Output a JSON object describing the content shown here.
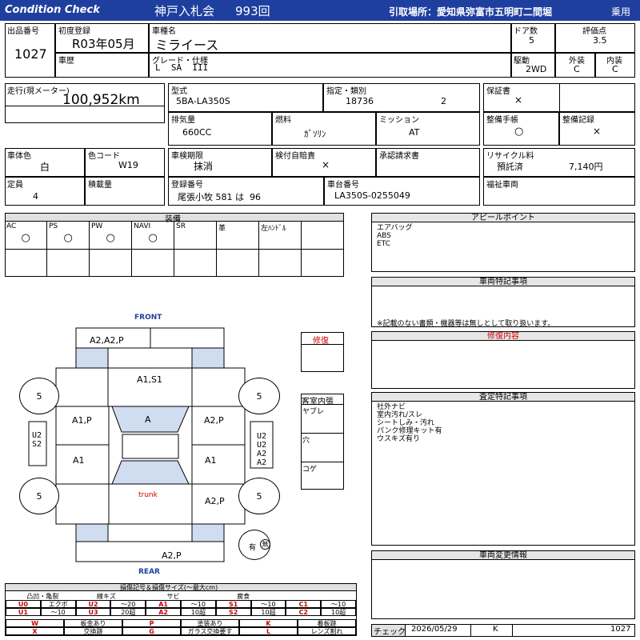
{
  "header": {
    "brand": "Condition Check",
    "auction": "神戸入札会",
    "lot_no": "993回",
    "pickup": "引取場所：愛知県弥富市五明町二間堀",
    "category": "乗用"
  },
  "row1": {
    "lot_label": "出品番号",
    "lot_value": "1027",
    "reg_label": "初度登録",
    "reg_value": "R03年05月",
    "history_label": "車歴",
    "name_label": "車種名",
    "name_value": "ミライース",
    "grade_label": "グレード・仕様",
    "grade_value": "L  SA  III",
    "doors_label": "ドア数",
    "doors_value": "5",
    "score_label": "評価点",
    "score_value": "3.5",
    "drive_label": "駆動",
    "drive_value": "2WD",
    "ext_label": "外装",
    "ext_value": "C",
    "int_label": "内装",
    "int_value": "C"
  },
  "row2": {
    "mileage_label": "走行(現メーター)",
    "mileage_value": "100,952km",
    "model_label": "型式",
    "model_value": "5BA-LA350S",
    "type_label": "指定・類別",
    "type_value1": "18736",
    "type_value2": "2",
    "warranty_label": "保証書",
    "warranty_value": "×",
    "disp_label": "排気量",
    "disp_value": "660CC",
    "fuel_label": "燃料",
    "fuel_value": "ｶﾞｿﾘﾝ",
    "mission_label": "ミッション",
    "mission_value": "AT",
    "manual_label": "整備手帳",
    "manual_value": "○",
    "record_label": "整備記録",
    "record_value": "×"
  },
  "row3": {
    "color_label": "車体色",
    "color_value": "白",
    "code_label": "色コード",
    "code_value": "W19",
    "inspect_label": "車検期限",
    "inspect_value": "抹消",
    "insure_label": "検付自賠責",
    "insure_value": "×",
    "claim_label": "承認請求書",
    "recycle_label": "リサイクル料",
    "recycle_status": "預託済",
    "recycle_value": "7,140円",
    "cap_label": "定員",
    "cap_value": "4",
    "load_label": "積載量",
    "plate_label": "登録番号",
    "plate_value": "尾張小牧 581 は  96",
    "chassis_label": "車台番号",
    "chassis_value": "LA350S-0255049",
    "welfare_label": "福祉車両"
  },
  "equipment": {
    "title": "装備",
    "items": [
      {
        "label": "AC",
        "mark": "○"
      },
      {
        "label": "PS",
        "mark": "○"
      },
      {
        "label": "PW",
        "mark": "○"
      },
      {
        "label": "NAVI",
        "mark": "○"
      },
      {
        "label": "SR",
        "mark": ""
      },
      {
        "label": "革",
        "mark": ""
      },
      {
        "label": "左ﾊﾝﾄﾞﾙ",
        "mark": ""
      }
    ]
  },
  "diagram": {
    "front": "FRONT",
    "rear": "REAR",
    "trunk": "trunk",
    "front_bumper": "A2,A2,P",
    "hood": "A1,S1",
    "roof": "A",
    "front_left": "A1,P",
    "front_right": "A2,P",
    "rear_left": "A1",
    "rear_right": "A1",
    "rear_quarter_right": "A2,P",
    "rear_bumper": "A2,P",
    "tire_fl": "5",
    "tire_fr": "5",
    "tire_rl": "5",
    "tire_rr": "5",
    "left_side": "U2\nS2",
    "right_side": "U2\nU2\nA2\nA2",
    "spare": "有",
    "spare_mark": "無"
  },
  "repair": {
    "title": "修復"
  },
  "cabin": {
    "title": "客室内張",
    "items": [
      "ヤブレ",
      "穴",
      "コゲ"
    ]
  },
  "appeal": {
    "title": "アピールポイント",
    "lines": [
      "エアバッグ",
      "ABS",
      "ETC"
    ]
  },
  "special": {
    "title": "車両特記事項",
    "note": "※記載のない書類・機器等は無しとして取り扱います。"
  },
  "repair_detail": {
    "title": "修復内容"
  },
  "assess": {
    "title": "査定特記事項",
    "lines": [
      "社外ナビ",
      "室内汚れ/スレ",
      "シートしみ・汚れ",
      "パンク修理キット有",
      "ウスキズ有り"
    ]
  },
  "change": {
    "title": "車両変更情報"
  },
  "legend": {
    "title": "損傷記号＆損傷サイズ(～最大cm)",
    "groups": [
      "凸凹・亀裂",
      "線キズ",
      "サビ",
      "腐食"
    ],
    "rows": [
      [
        "U0",
        "エクボ",
        "U2",
        "～20",
        "A1",
        "～10",
        "S1",
        "～10",
        "C1",
        "～10"
      ],
      [
        "U1",
        "～10",
        "U3",
        "20超",
        "A2",
        "10超",
        "S2",
        "10超",
        "C2",
        "10超"
      ]
    ],
    "other": [
      [
        "W",
        "板金あり",
        "P",
        "塗装あり",
        "K",
        "着板跡"
      ],
      [
        "X",
        "交換跡",
        "G",
        "ガラス交換要す",
        "L",
        "レンズ割れ"
      ]
    ]
  },
  "footer": {
    "check_label": "チェック",
    "date": "2026/05/29",
    "checker": "K",
    "lot": "1027"
  },
  "colors": {
    "header_blue": "#1f3f9f",
    "panel_blue": "#d0dcf0",
    "red": "#cc0000"
  }
}
